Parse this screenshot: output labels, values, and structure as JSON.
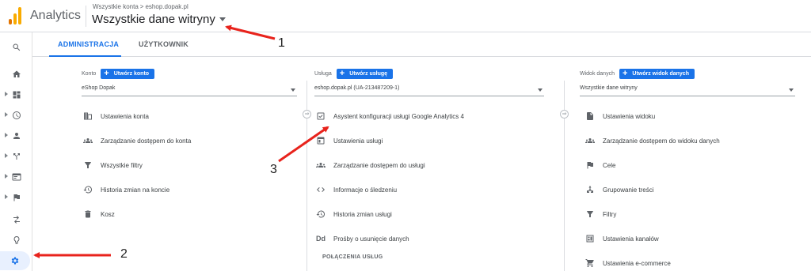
{
  "header": {
    "app_name": "Analytics",
    "breadcrumb": {
      "account": "Wszystkie konta",
      "separator": ">",
      "property": "eshop.dopak.pl"
    },
    "view_name": "Wszystkie dane witryny"
  },
  "tabs": [
    {
      "label": "ADMINISTRACJA",
      "active": true
    },
    {
      "label": "UŻYTKOWNIK",
      "active": false
    }
  ],
  "rail": {
    "items": [
      "search-icon",
      "home-icon",
      "dashboard-icon",
      "clock-icon",
      "person-icon",
      "acquisition-icon",
      "behavior-icon",
      "flag-icon",
      "attribution-icon",
      "lightbulb-icon",
      "gear-icon"
    ]
  },
  "columns": {
    "account": {
      "label": "Konto",
      "create_button": "Utwórz konto",
      "selected": "eShop Dopak",
      "items": [
        {
          "icon": "building-icon",
          "label": "Ustawienia konta"
        },
        {
          "icon": "people-icon",
          "label": "Zarządzanie dostępem do konta"
        },
        {
          "icon": "filter-icon",
          "label": "Wszystkie filtry"
        },
        {
          "icon": "history-icon",
          "label": "Historia zmian na koncie"
        },
        {
          "icon": "trash-icon",
          "label": "Kosz"
        }
      ]
    },
    "property": {
      "label": "Usługa",
      "create_button": "Utwórz usługę",
      "selected": "eshop.dopak.pl (UA-213487209-1)",
      "items": [
        {
          "icon": "checkbox-icon",
          "label": "Asystent konfiguracji usługi Google Analytics 4"
        },
        {
          "icon": "window-icon",
          "label": "Ustawienia usługi"
        },
        {
          "icon": "people-icon",
          "label": "Zarządzanie dostępem do usługi"
        },
        {
          "icon": "code-icon",
          "label": "Informacje o śledzeniu"
        },
        {
          "icon": "history-icon",
          "label": "Historia zmian usługi"
        },
        {
          "icon": "dd-icon",
          "icon_text": "Dd",
          "label": "Prośby o usunięcie danych"
        }
      ],
      "section_title": "POŁĄCZENIA USŁUG"
    },
    "view": {
      "label": "Widok danych",
      "create_button": "Utwórz widok danych",
      "selected": "Wszystkie dane witryny",
      "items": [
        {
          "icon": "document-icon",
          "label": "Ustawienia widoku"
        },
        {
          "icon": "people-icon",
          "label": "Zarządzanie dostępem do widoku danych"
        },
        {
          "icon": "flag-icon",
          "label": "Cele"
        },
        {
          "icon": "grouping-icon",
          "label": "Grupowanie treści"
        },
        {
          "icon": "filter-icon",
          "label": "Filtry"
        },
        {
          "icon": "channel-icon",
          "label": "Ustawienia kanałów"
        },
        {
          "icon": "cart-icon",
          "label": "Ustawienia e-commerce"
        }
      ]
    }
  },
  "annotations": [
    "1",
    "2",
    "3"
  ],
  "colors": {
    "accent": "#1a73e8",
    "annotation_arrow": "#e8231c",
    "logo_orange": "#f9ab00",
    "logo_dark_orange": "#e37400"
  }
}
